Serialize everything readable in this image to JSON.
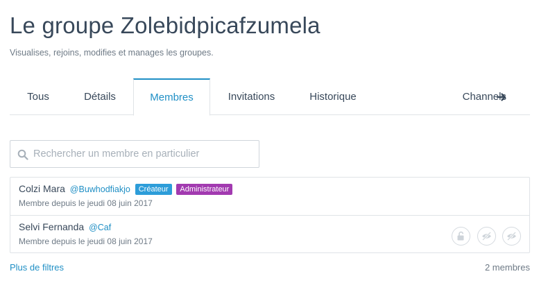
{
  "header": {
    "title": "Le groupe Zolebidpicafzumela",
    "subtitle": "Visualises, rejoins, modifies et manages les groupes."
  },
  "tabs": [
    {
      "label": "Tous",
      "active": false
    },
    {
      "label": "Détails",
      "active": false
    },
    {
      "label": "Membres",
      "active": true
    },
    {
      "label": "Invitations",
      "active": false
    },
    {
      "label": "Historique",
      "active": false
    },
    {
      "label": "Channels",
      "active": false,
      "icon": "arrow-right-icon"
    }
  ],
  "search": {
    "placeholder": "Rechercher un membre en particulier",
    "value": "",
    "icon": "search-icon"
  },
  "members": [
    {
      "name": "Colzi Mara",
      "handle": "@Buwhodfiakjo",
      "badges": [
        "Créateur",
        "Administrateur"
      ],
      "since": "Membre depuis le jeudi 08 juin 2017"
    },
    {
      "name": "Selvi Fernanda",
      "handle": "@Caf",
      "badges": [],
      "since": "Membre depuis le jeudi 08 juin 2017",
      "actions": [
        "unlock-icon",
        "eye-slash-icon",
        "eye-slash-icon"
      ]
    }
  ],
  "footer": {
    "more_filters": "Plus de filtres",
    "count": "2 membres"
  },
  "colors": {
    "accent": "#1f8fc5",
    "badge_creator": "#2d9dd9",
    "badge_admin": "#a23ab0",
    "text": "#38485a",
    "muted": "#6e7a86",
    "border": "#dfe3e7"
  }
}
